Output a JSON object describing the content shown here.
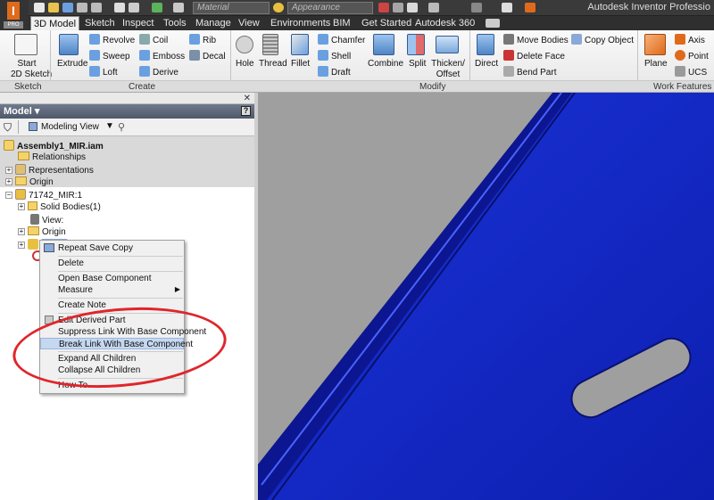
{
  "app": {
    "title": "Autodesk Inventor Professio",
    "badge": "PRO"
  },
  "qat": {
    "material_placeholder": "Material",
    "appearance_placeholder": "Appearance"
  },
  "ribbon_tabs": [
    "3D Model",
    "Sketch",
    "Inspect",
    "Tools",
    "Manage",
    "View",
    "Environments",
    "BIM",
    "Get Started",
    "Autodesk 360"
  ],
  "panels": {
    "sketch": {
      "label": "Sketch",
      "start_sketch_1": "Start",
      "start_sketch_2": "2D Sketch"
    },
    "create": {
      "label": "Create",
      "extrude": "Extrude",
      "revolve": "Revolve",
      "sweep": "Sweep",
      "loft": "Loft",
      "coil": "Coil",
      "emboss": "Emboss",
      "derive": "Derive",
      "rib": "Rib",
      "decal": "Decal"
    },
    "modify": {
      "label": "Modify",
      "hole": "Hole",
      "thread": "Thread",
      "fillet": "Fillet",
      "chamfer": "Chamfer",
      "shell": "Shell",
      "draft": "Draft",
      "combine": "Combine",
      "split": "Split",
      "thicken_1": "Thicken/",
      "thicken_2": "Offset",
      "direct": "Direct",
      "move_bodies": "Move Bodies",
      "delete_face": "Delete Face",
      "bend_part": "Bend Part",
      "copy_object": "Copy Object"
    },
    "work_features": {
      "label": "Work Features",
      "plane": "Plane",
      "axis": "Axis",
      "point": "Point",
      "ucs": "UCS"
    }
  },
  "browser": {
    "title": "Model",
    "view_mode": "Modeling View",
    "tree": {
      "root": "Assembly1_MIR.iam",
      "relationships": "Relationships",
      "representations": "Representations",
      "origin": "Origin",
      "part": "71742_MIR:1",
      "solid_bodies": "Solid Bodies(1)",
      "view": "View:",
      "part_origin": "Origin"
    }
  },
  "context_menu": {
    "items": [
      "Repeat Save Copy",
      "Delete",
      "Open Base Component",
      "Measure",
      "Create Note",
      "Edit Derived Part",
      "Suppress Link With Base Component",
      "Break Link With Base Component",
      "Expand All Children",
      "Collapse All Children",
      "How To..."
    ],
    "highlighted_index": 7
  },
  "colors": {
    "part_blue": "#1428c8",
    "viewport_bg": "#9f9f9f",
    "highlight_ring": "#e0252a",
    "menu_highlight": "#c5d8f0"
  }
}
